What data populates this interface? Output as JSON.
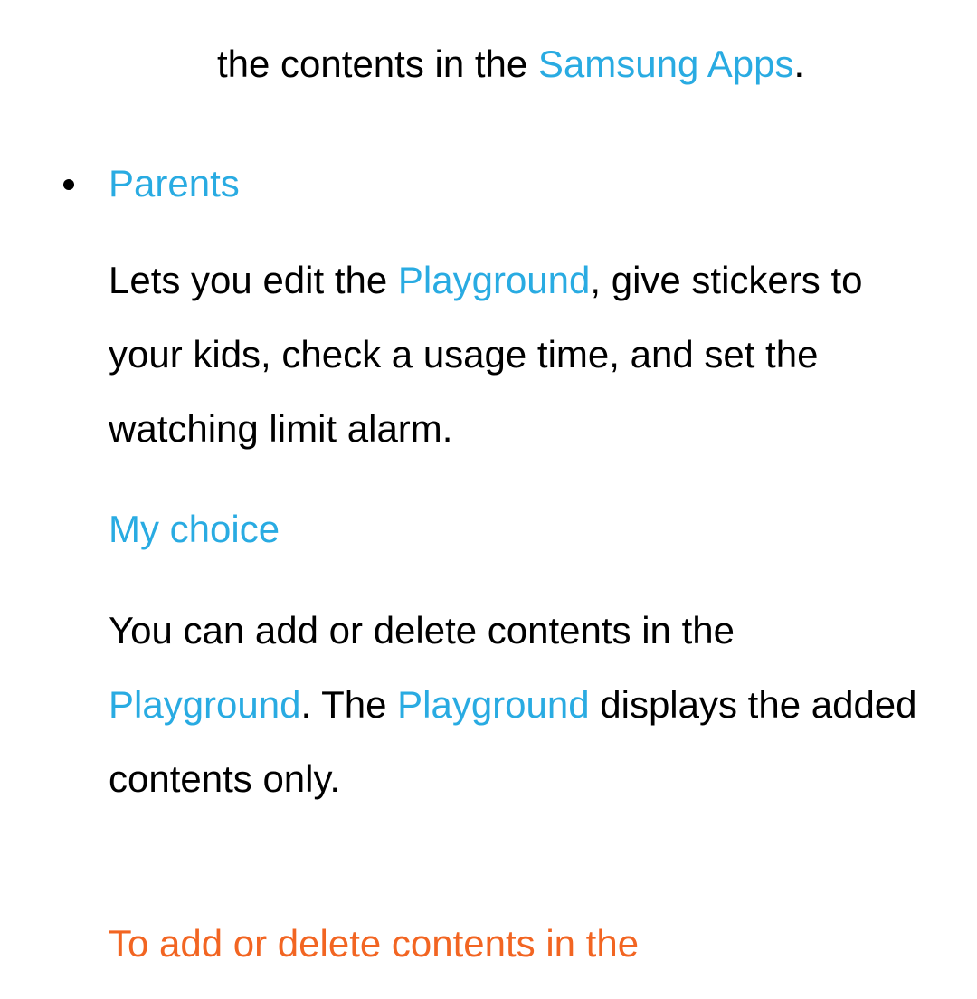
{
  "topLine": {
    "pre": "the contents in the ",
    "link": "Samsung Apps",
    "post": "."
  },
  "bulletTitle": "Parents",
  "para1": {
    "pre": "Lets you edit the ",
    "link1": "Playground",
    "post": ", give stickers to your kids, check a usage time, and set the watching limit alarm."
  },
  "subTitle": "My choice",
  "para2": {
    "pre": "You can add or delete contents in the ",
    "link1": "Playground",
    "mid": ". The ",
    "link2": "Playground",
    "post": " displays the added contents only."
  },
  "orangeHeading": "To add or delete contents in the"
}
